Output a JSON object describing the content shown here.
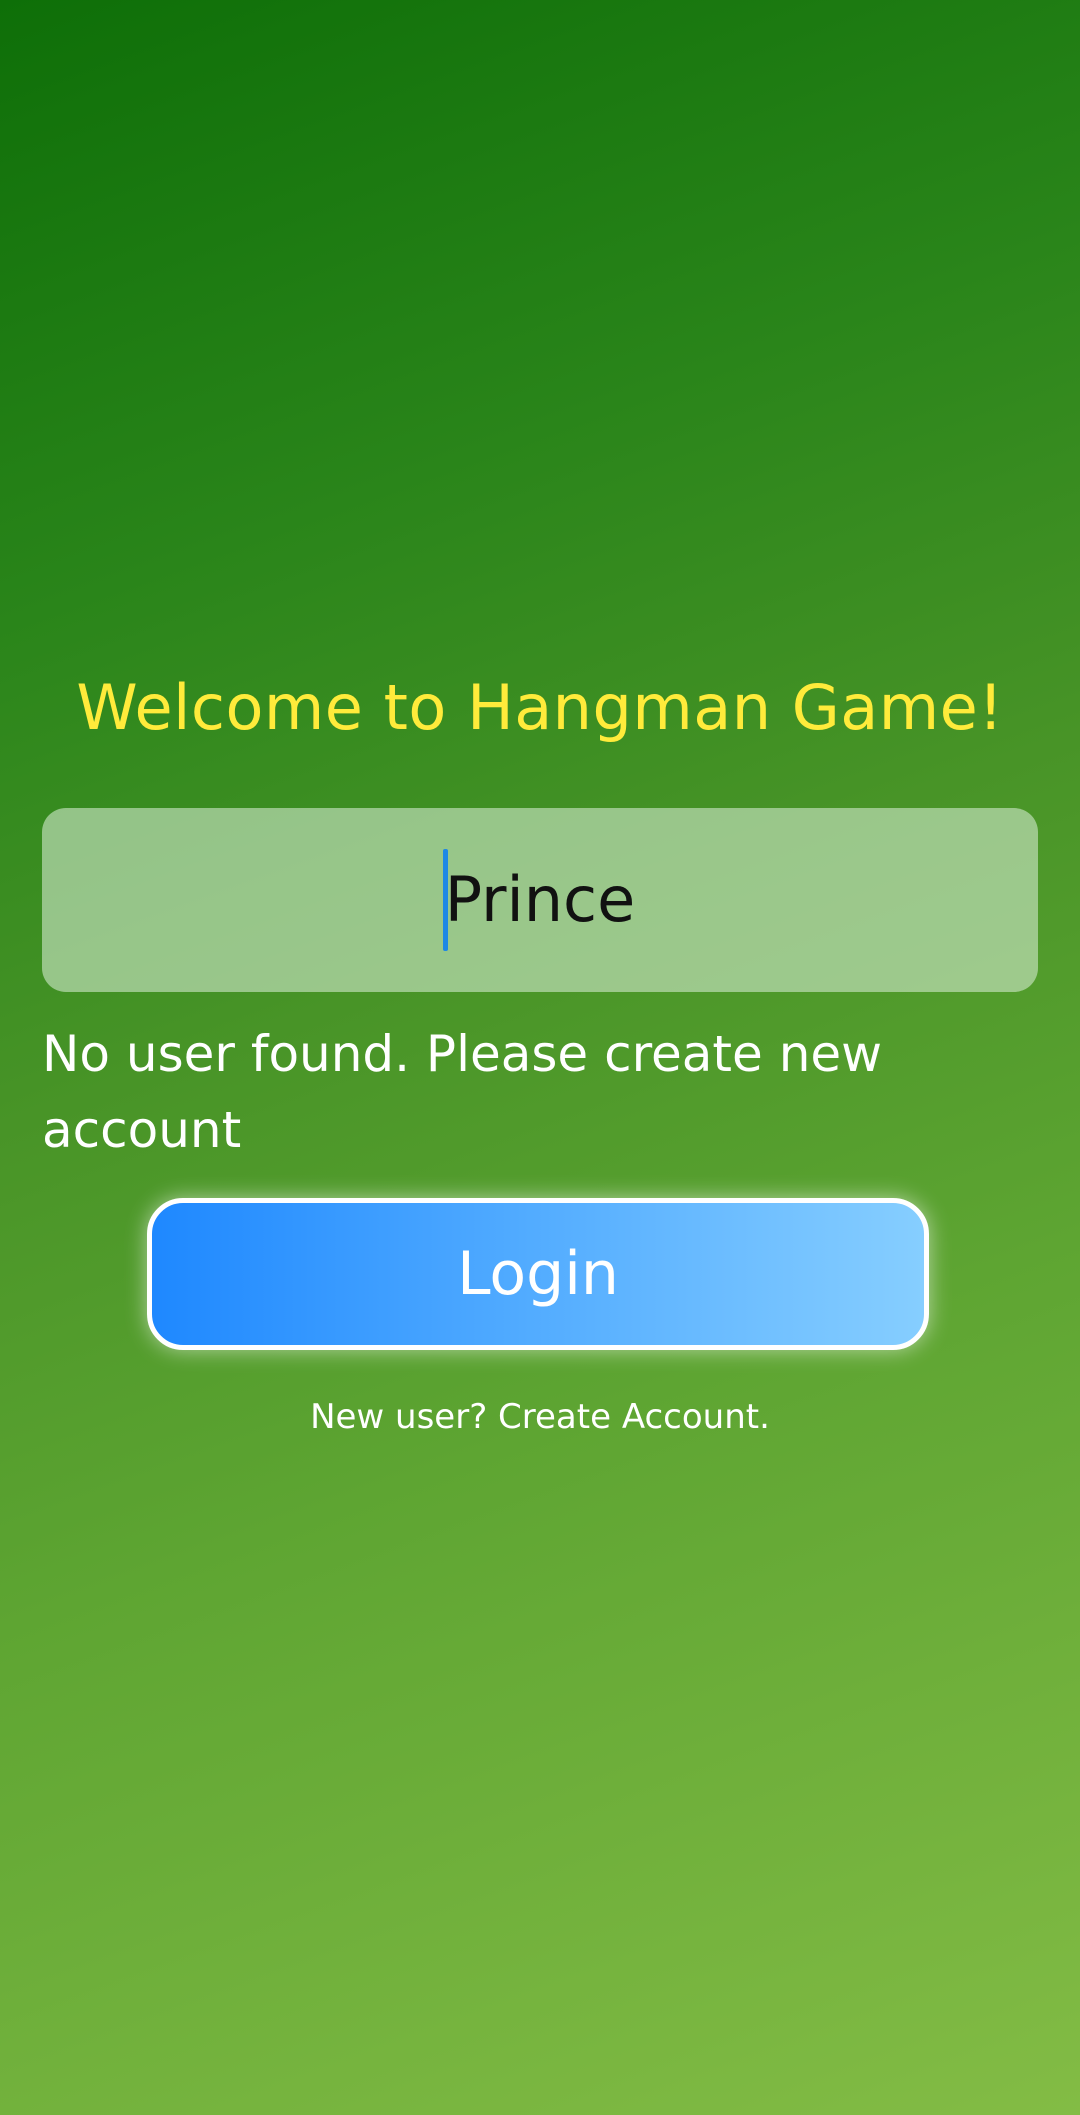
{
  "title": "Welcome to Hangman Game!",
  "username_input": {
    "value": "Prince"
  },
  "error_message": "No user found. Please create new account",
  "login_button": {
    "label": "Login"
  },
  "create_account_link": "New user? Create Account.",
  "colors": {
    "title": "#ffeb3b",
    "button_start": "#1e88ff",
    "button_end": "#86ceff",
    "caret": "#1e88e5"
  }
}
